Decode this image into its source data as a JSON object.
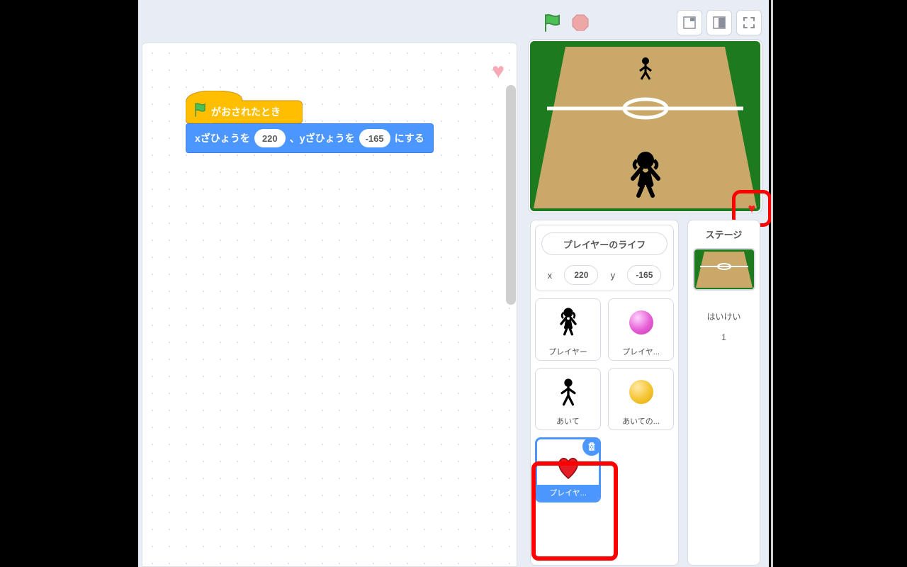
{
  "blocks": {
    "hat_label": "がおされたとき",
    "goto_prefix": "xざひょうを",
    "goto_mid": "、yざひょうを",
    "goto_suffix": "にする",
    "x_arg": "220",
    "y_arg": "-165"
  },
  "sprite_info": {
    "name": "プレイヤーのライフ",
    "x_label": "x",
    "x_value": "220",
    "y_label": "y",
    "y_value": "-165"
  },
  "sprites": [
    {
      "label": "プレイヤー",
      "icon": "player"
    },
    {
      "label": "プレイヤ...",
      "icon": "ball-pink"
    },
    {
      "label": "あいて",
      "icon": "opponent"
    },
    {
      "label": "あいての...",
      "icon": "ball-orange"
    },
    {
      "label": "プレイヤ...",
      "icon": "heart",
      "selected": true
    }
  ],
  "stage_panel": {
    "title": "ステージ",
    "backdrop_label": "はいけい",
    "backdrop_count": "1"
  },
  "icons": {
    "heart": "♥"
  }
}
